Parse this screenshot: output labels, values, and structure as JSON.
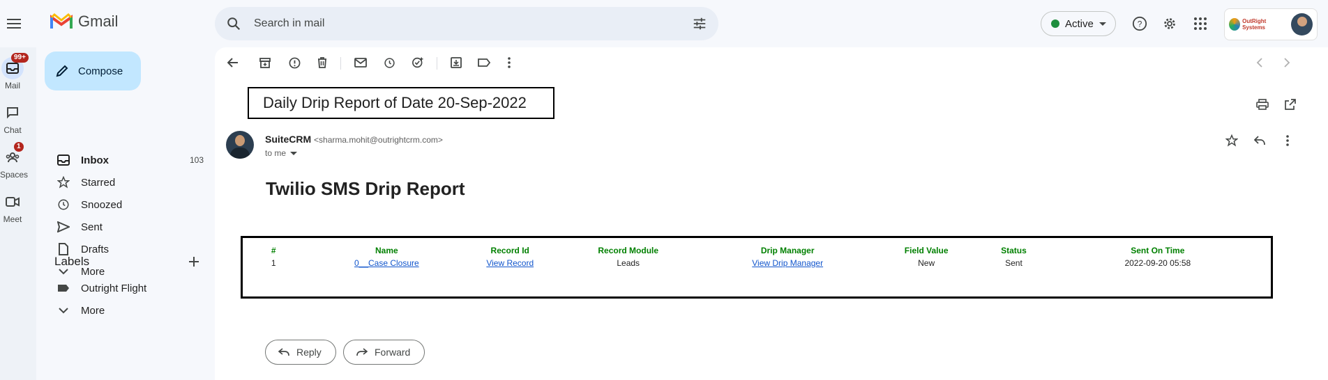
{
  "app": {
    "name": "Gmail"
  },
  "search": {
    "placeholder": "Search in mail"
  },
  "status": {
    "label": "Active"
  },
  "account": {
    "brand": "OutRight Systems"
  },
  "rail": [
    {
      "label": "Mail",
      "badge": "99+"
    },
    {
      "label": "Chat",
      "badge": ""
    },
    {
      "label": "Spaces",
      "badge": "1"
    },
    {
      "label": "Meet",
      "badge": ""
    }
  ],
  "compose": {
    "label": "Compose"
  },
  "nav": {
    "inbox": {
      "label": "Inbox",
      "count": "103"
    },
    "starred": {
      "label": "Starred"
    },
    "snoozed": {
      "label": "Snoozed"
    },
    "sent": {
      "label": "Sent"
    },
    "drafts": {
      "label": "Drafts"
    },
    "more": {
      "label": "More"
    }
  },
  "labels": {
    "heading": "Labels",
    "items": [
      {
        "label": "Outright Flight"
      }
    ],
    "more": "More"
  },
  "email": {
    "subject": "Daily Drip Report of Date 20-Sep-2022",
    "sender_name": "SuiteCRM",
    "sender_email": "<sharma.mohit@outrightcrm.com>",
    "to": "to me",
    "body_title": "Twilio SMS Drip Report",
    "table": {
      "headers": [
        "#",
        "Name",
        "Record Id",
        "Record Module",
        "Drip Manager",
        "Field Value",
        "Status",
        "Sent On Time"
      ],
      "row": {
        "num": "1",
        "name": "0__Case Closure",
        "record_id": "View Record",
        "module": "Leads",
        "drip_manager": "View Drip Manager",
        "field_value": "New",
        "status": "Sent",
        "sent_on": "2022-09-20 05:58"
      }
    },
    "reply_label": "Reply",
    "forward_label": "Forward"
  },
  "colors": {
    "header_green": "#008000",
    "link_blue": "#1155cc",
    "compose_bg": "#c2e7ff",
    "active_dot": "#1e8e3e"
  }
}
